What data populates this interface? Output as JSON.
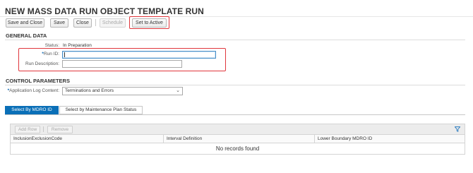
{
  "header": {
    "title": "NEW MASS DATA RUN OBJECT TEMPLATE RUN"
  },
  "toolbar": {
    "save_and_close": "Save and Close",
    "save": "Save",
    "close": "Close",
    "schedule": "Schedule",
    "set_to_active": "Set to Active"
  },
  "general": {
    "heading": "GENERAL DATA",
    "status_label": "Status:",
    "status_value": "In Preparation",
    "run_id_label": "Run ID:",
    "run_id_value": "",
    "run_desc_label": "Run Description:",
    "run_desc_value": ""
  },
  "control": {
    "heading": "CONTROL PARAMETERS",
    "app_log_label": "Application Log Content:",
    "app_log_value": "Terminations and Errors"
  },
  "tabs": [
    {
      "label": "Select By MDRO ID",
      "active": true
    },
    {
      "label": "Select by Maintenance Plan Status",
      "active": false
    }
  ],
  "table": {
    "add_row": "Add Row",
    "remove": "Remove",
    "columns": [
      "InclusionExclusionCode",
      "Interval Definition",
      "Lower Boundary MDRO ID"
    ],
    "empty_text": "No records found"
  },
  "colors": {
    "accent": "#0a6fb7",
    "highlight_box": "#e0363c",
    "required_marker": "#0a66b2"
  },
  "icons": {
    "filter": "filter-icon",
    "dropdown": "chevron-down-icon"
  }
}
